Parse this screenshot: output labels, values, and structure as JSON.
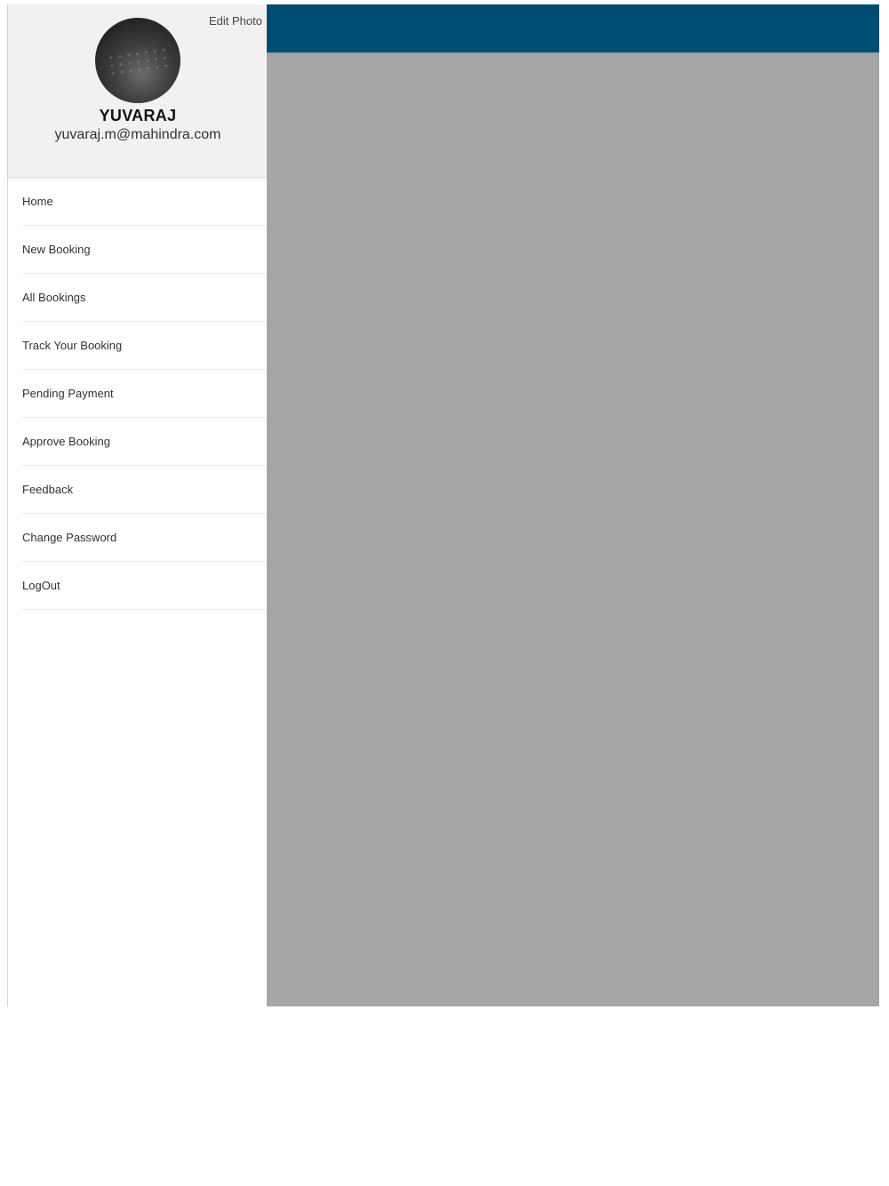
{
  "drawer": {
    "edit_photo_label": "Edit Photo",
    "user": {
      "name": "YUVARAJ",
      "email": "yuvaraj.m@mahindra.com"
    },
    "menu": [
      {
        "label": "Home"
      },
      {
        "label": "New Booking"
      },
      {
        "label": "All Bookings"
      },
      {
        "label": "Track Your Booking"
      },
      {
        "label": "Pending Payment"
      },
      {
        "label": "Approve Booking"
      },
      {
        "label": "Feedback"
      },
      {
        "label": "Change Password"
      },
      {
        "label": "LogOut"
      }
    ]
  },
  "colors": {
    "header_bar": "#004d73",
    "overlay": "#a6a6a6",
    "drawer_header_bg": "#f2f1f0"
  }
}
